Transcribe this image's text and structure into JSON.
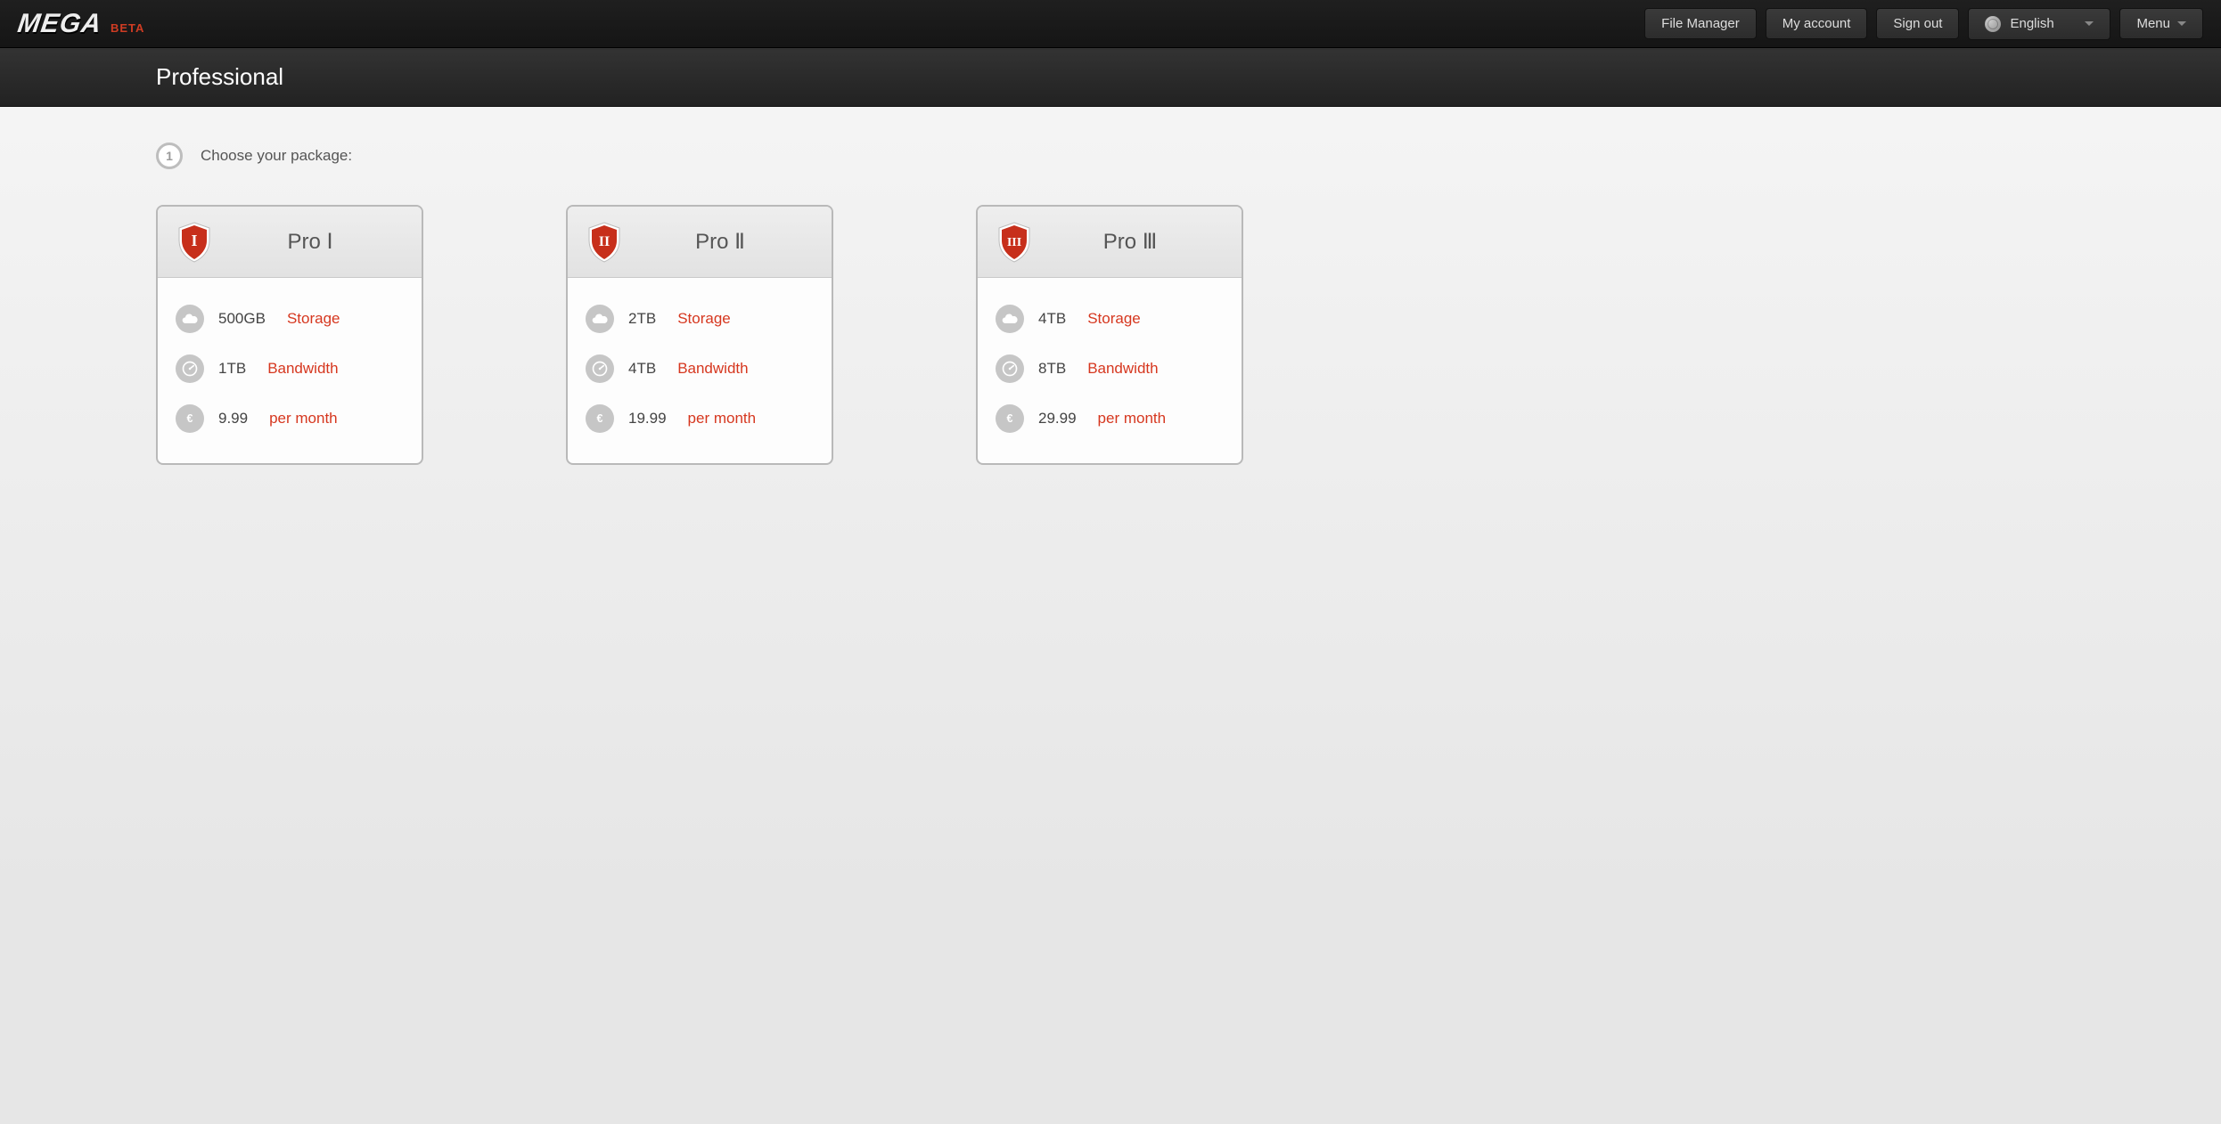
{
  "brand": {
    "name": "MEGA",
    "tag": "BETA"
  },
  "nav": {
    "file_manager": "File Manager",
    "my_account": "My account",
    "sign_out": "Sign out",
    "language": "English",
    "menu": "Menu"
  },
  "page_title": "Professional",
  "step": {
    "number": "1",
    "label": "Choose your package:"
  },
  "labels": {
    "storage": "Storage",
    "bandwidth": "Bandwidth",
    "per_month": "per month"
  },
  "tiers": [
    {
      "name": "Pro Ⅰ",
      "storage": "500GB",
      "bandwidth": "1TB",
      "price": "9.99"
    },
    {
      "name": "Pro Ⅱ",
      "storage": "2TB",
      "bandwidth": "4TB",
      "price": "19.99"
    },
    {
      "name": "Pro Ⅲ",
      "storage": "4TB",
      "bandwidth": "8TB",
      "price": "29.99"
    }
  ]
}
